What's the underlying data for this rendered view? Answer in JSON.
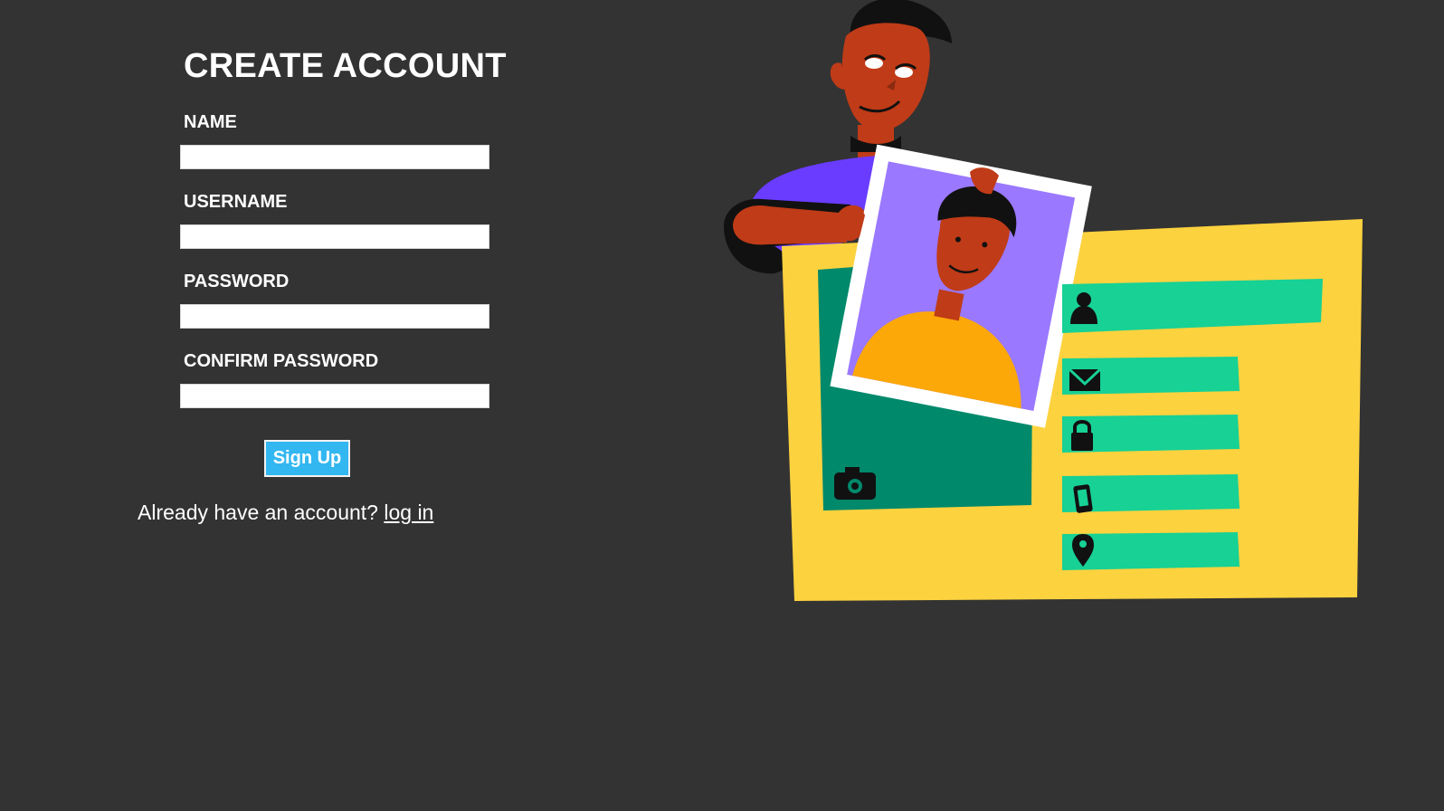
{
  "form": {
    "title": "CREATE ACCOUNT",
    "fields": [
      {
        "label": "NAME",
        "value": ""
      },
      {
        "label": "USERNAME",
        "value": ""
      },
      {
        "label": "PASSWORD",
        "value": ""
      },
      {
        "label": "CONFIRM PASSWORD",
        "value": ""
      }
    ],
    "submit_label": "Sign Up",
    "login_prompt": "Already have an account? ",
    "login_link": "log in"
  },
  "colors": {
    "background": "#333333",
    "button": "#33b7f1",
    "card": "#fdd23f",
    "field_bar": "#17d195",
    "photo_frame": "#00896b",
    "photo_bg": "#9a78ff",
    "shirt": "#6a3cff",
    "skin": "#c03b17"
  },
  "illustration": {
    "icons": [
      "camera-icon",
      "user-icon",
      "mail-icon",
      "lock-icon",
      "phone-icon",
      "location-pin-icon"
    ]
  }
}
